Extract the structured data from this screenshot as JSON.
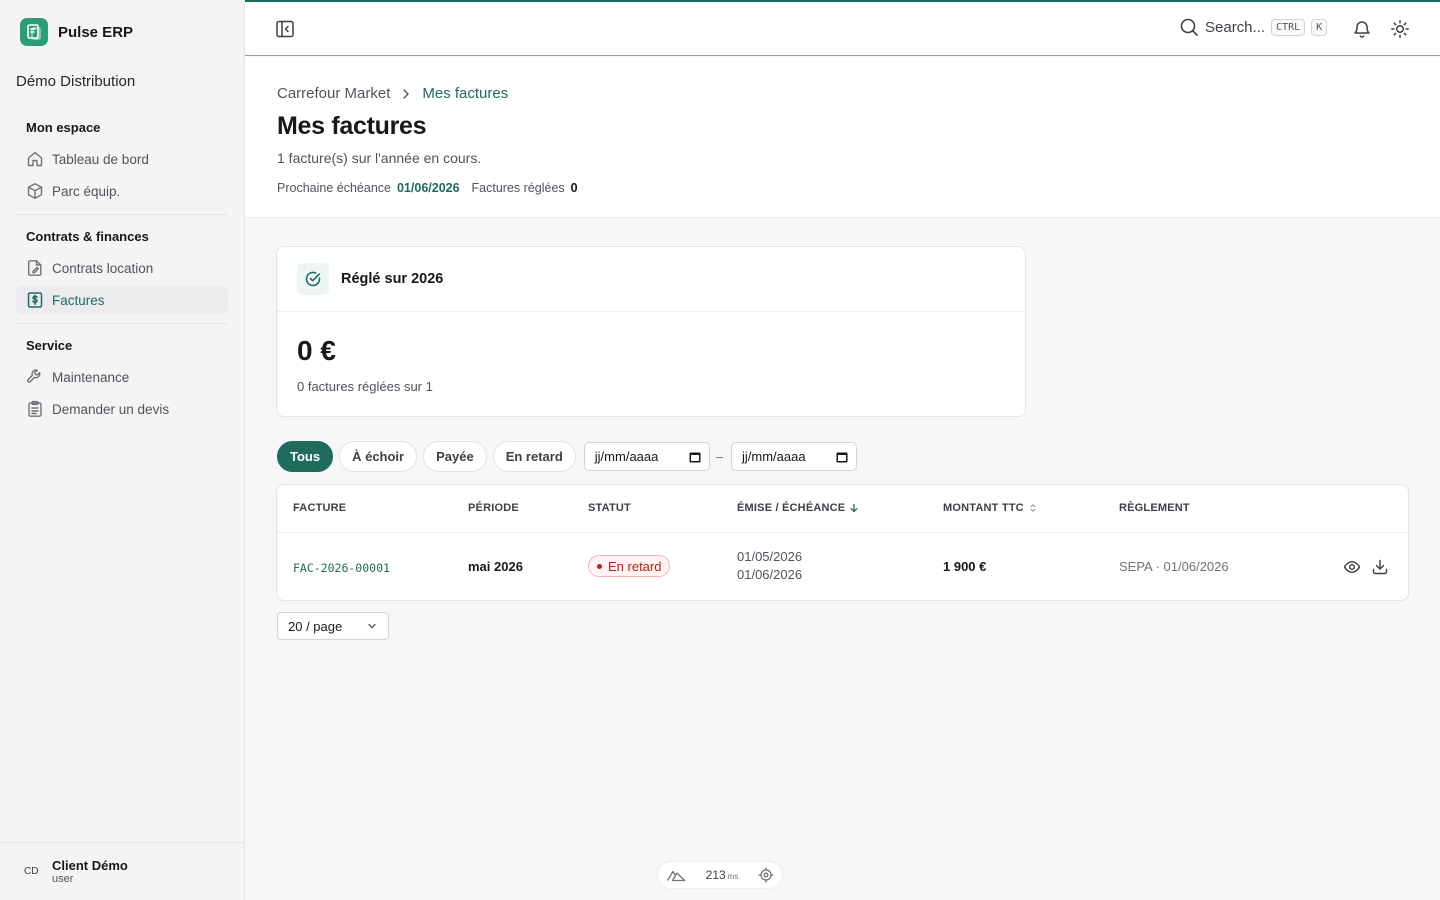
{
  "app": {
    "name": "Pulse ERP",
    "org": "Démo Distribution"
  },
  "sidebar": {
    "groups": [
      {
        "title": "Mon espace",
        "items": [
          {
            "label": "Tableau de bord",
            "icon": "home-icon"
          },
          {
            "label": "Parc équip.",
            "icon": "box-icon"
          }
        ]
      },
      {
        "title": "Contrats & finances",
        "items": [
          {
            "label": "Contrats location",
            "icon": "file-edit-icon"
          },
          {
            "label": "Factures",
            "icon": "dollar-receipt-icon",
            "active": true
          }
        ]
      },
      {
        "title": "Service",
        "items": [
          {
            "label": "Maintenance",
            "icon": "wrench-icon"
          },
          {
            "label": "Demander un devis",
            "icon": "clipboard-icon"
          }
        ]
      }
    ],
    "user": {
      "initials": "CD",
      "name": "Client Démo",
      "role": "user"
    }
  },
  "header": {
    "search_label": "Search...",
    "kbd_ctrl": "CTRL",
    "kbd_k": "K"
  },
  "breadcrumb": {
    "parent": "Carrefour Market",
    "current": "Mes factures"
  },
  "page": {
    "title": "Mes factures",
    "subtitle": "1 facture(s) sur l'année en cours.",
    "next_due_label": "Prochaine échéance",
    "next_due_value": "01/06/2026",
    "paid_label": "Factures réglées",
    "paid_value": "0"
  },
  "summary_card": {
    "title": "Réglé sur 2026",
    "amount": "0 €",
    "note": "0 factures réglées sur 1"
  },
  "filters": {
    "chips": [
      "Tous",
      "À échoir",
      "Payée",
      "En retard"
    ],
    "active": "Tous",
    "date_from_placeholder": "jj/mm/aaaa",
    "date_separator": "–",
    "date_to_placeholder": "jj/mm/aaaa"
  },
  "table": {
    "columns": [
      "FACTURE",
      "PÉRIODE",
      "STATUT",
      "ÉMISE / ÉCHÉANCE",
      "MONTANT TTC",
      "RÈGLEMENT"
    ],
    "rows": [
      {
        "invoice": "FAC-2026-00001",
        "period": "mai 2026",
        "status": "En retard",
        "issued": "01/05/2026",
        "due": "01/06/2026",
        "amount": "1 900 €",
        "payment": "SEPA · 01/06/2026"
      }
    ]
  },
  "pagination": {
    "per_page": "20 / page"
  },
  "devbar": {
    "value": "213",
    "unit": "ms"
  },
  "colors": {
    "accent": "#1f6b5e",
    "danger": "#b42318",
    "brand": "#2d9d78"
  }
}
